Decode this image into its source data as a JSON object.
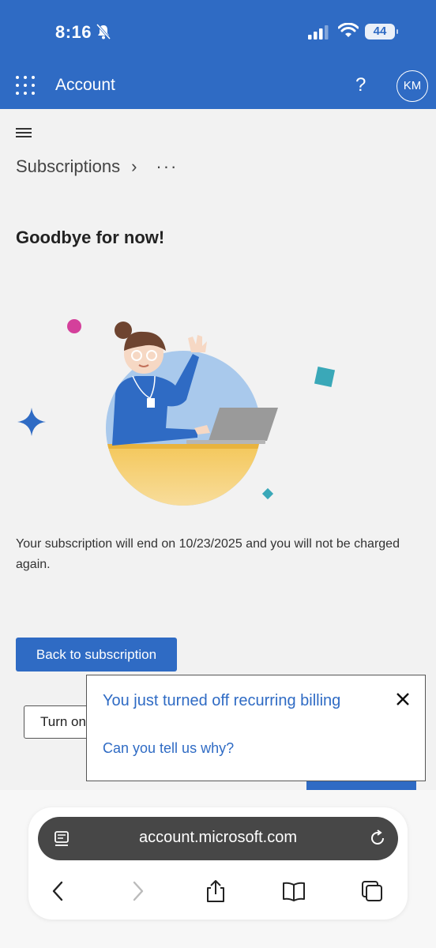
{
  "status_bar": {
    "time": "8:16",
    "battery": "44"
  },
  "header": {
    "title": "Account",
    "help": "?",
    "avatar_initials": "KM"
  },
  "breadcrumb": {
    "current": "Subscriptions",
    "chevron": "›",
    "more": "···"
  },
  "content": {
    "headline": "Goodbye for now!",
    "message": "Your subscription will end on 10/23/2025 and you will not be charged again.",
    "back_button": "Back to subscription",
    "turn_on_button": "Turn on"
  },
  "popup": {
    "title": "You just turned off recurring billing",
    "link": "Can you tell us why?"
  },
  "browser": {
    "url": "account.microsoft.com"
  },
  "colors": {
    "accent": "#2f6bc4",
    "background": "#f2f2f2"
  }
}
